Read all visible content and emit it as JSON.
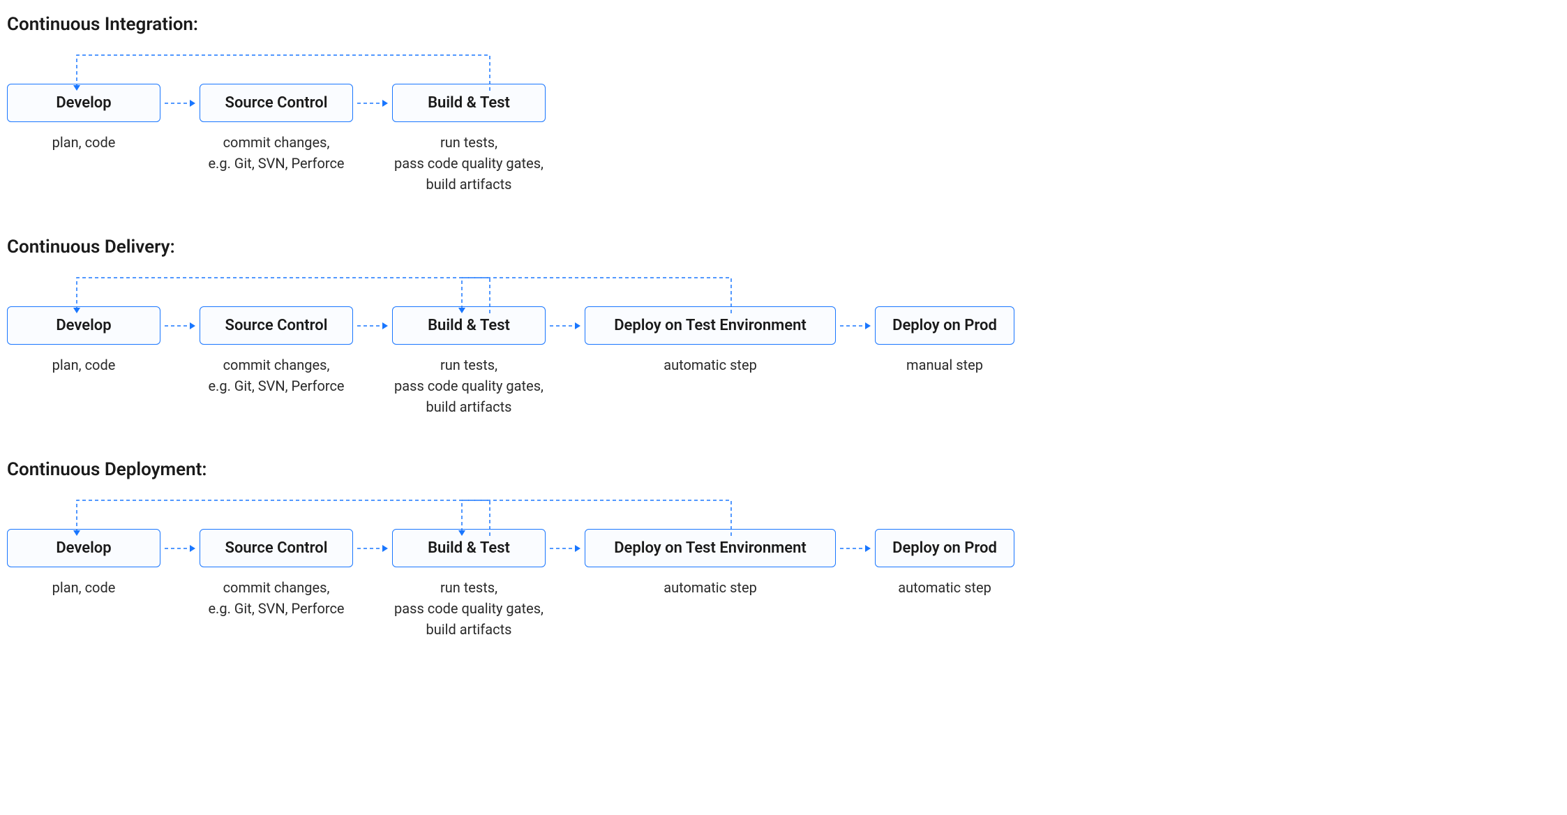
{
  "sections": [
    {
      "title": "Continuous Integration:",
      "stages": [
        {
          "label": "Develop",
          "caption": "plan, code",
          "boxClass": ""
        },
        {
          "label": "Source Control",
          "caption": "commit changes,\ne.g. Git, SVN, Perforce",
          "boxClass": ""
        },
        {
          "label": "Build & Test",
          "caption": "run tests,\npass code quality gates,\nbuild artifacts",
          "boxClass": ""
        }
      ],
      "feedback": [
        {
          "from": 2,
          "to": 0
        }
      ]
    },
    {
      "title": "Continuous Delivery:",
      "stages": [
        {
          "label": "Develop",
          "caption": "plan, code",
          "boxClass": ""
        },
        {
          "label": "Source Control",
          "caption": "commit changes,\ne.g. Git, SVN, Perforce",
          "boxClass": ""
        },
        {
          "label": "Build & Test",
          "caption": "run tests,\npass code quality gates,\nbuild artifacts",
          "boxClass": ""
        },
        {
          "label": "Deploy on Test Environment",
          "caption": "automatic step",
          "boxClass": "wide"
        },
        {
          "label": "Deploy on Prod",
          "caption": "manual step",
          "boxClass": "small"
        }
      ],
      "feedback": [
        {
          "from": 2,
          "to": 0
        },
        {
          "from": 3,
          "to": 2
        }
      ]
    },
    {
      "title": "Continuous Deployment:",
      "stages": [
        {
          "label": "Develop",
          "caption": "plan, code",
          "boxClass": ""
        },
        {
          "label": "Source Control",
          "caption": "commit changes,\ne.g. Git, SVN, Perforce",
          "boxClass": ""
        },
        {
          "label": "Build & Test",
          "caption": "run tests,\npass code quality gates,\nbuild artifacts",
          "boxClass": ""
        },
        {
          "label": "Deploy on Test Environment",
          "caption": "automatic step",
          "boxClass": "wide"
        },
        {
          "label": "Deploy on Prod",
          "caption": "automatic step",
          "boxClass": "small"
        }
      ],
      "feedback": [
        {
          "from": 2,
          "to": 0
        },
        {
          "from": 3,
          "to": 2
        }
      ]
    }
  ],
  "colors": {
    "stroke": "#1976ff"
  }
}
